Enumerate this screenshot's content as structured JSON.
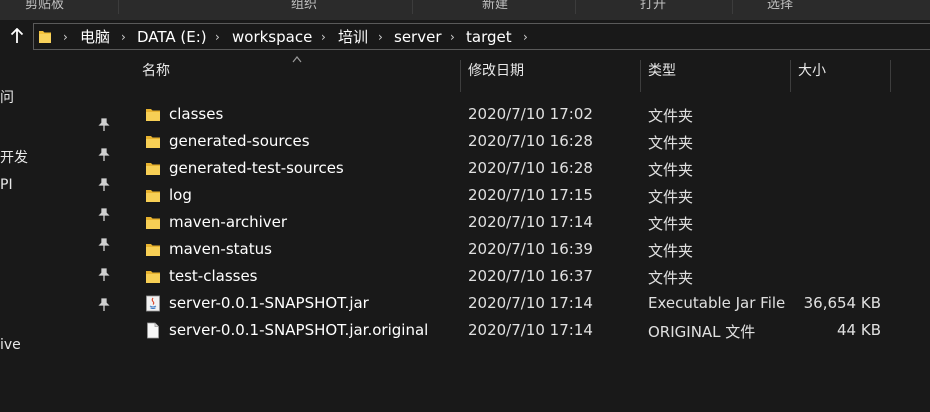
{
  "ribbon": {
    "items": [
      "剪贴板",
      "组织",
      "新建",
      "打开",
      "选择"
    ]
  },
  "address": {
    "breadcrumbs": [
      "电脑",
      "DATA (E:)",
      "workspace",
      "培训",
      "server",
      "target"
    ]
  },
  "nav": {
    "items": [
      "问",
      "开发",
      "PI",
      "ive"
    ]
  },
  "columns": {
    "name": "名称",
    "date": "修改日期",
    "type": "类型",
    "size": "大小"
  },
  "files": [
    {
      "name": "classes",
      "date": "2020/7/10 17:02",
      "type": "文件夹",
      "size": "",
      "icon": "folder-icon"
    },
    {
      "name": "generated-sources",
      "date": "2020/7/10 16:28",
      "type": "文件夹",
      "size": "",
      "icon": "folder-icon"
    },
    {
      "name": "generated-test-sources",
      "date": "2020/7/10 16:28",
      "type": "文件夹",
      "size": "",
      "icon": "folder-icon"
    },
    {
      "name": "log",
      "date": "2020/7/10 17:15",
      "type": "文件夹",
      "size": "",
      "icon": "folder-icon"
    },
    {
      "name": "maven-archiver",
      "date": "2020/7/10 17:14",
      "type": "文件夹",
      "size": "",
      "icon": "folder-icon"
    },
    {
      "name": "maven-status",
      "date": "2020/7/10 16:39",
      "type": "文件夹",
      "size": "",
      "icon": "folder-icon"
    },
    {
      "name": "test-classes",
      "date": "2020/7/10 16:37",
      "type": "文件夹",
      "size": "",
      "icon": "folder-icon"
    },
    {
      "name": "server-0.0.1-SNAPSHOT.jar",
      "date": "2020/7/10 17:14",
      "type": "Executable Jar File",
      "size": "36,654 KB",
      "icon": "java-jar-icon"
    },
    {
      "name": "server-0.0.1-SNAPSHOT.jar.original",
      "date": "2020/7/10 17:14",
      "type": "ORIGINAL 文件",
      "size": "44 KB",
      "icon": "file-icon"
    }
  ],
  "colors": {
    "background": "#191919",
    "folder": "#f3c13a",
    "text": "#ffffff"
  }
}
